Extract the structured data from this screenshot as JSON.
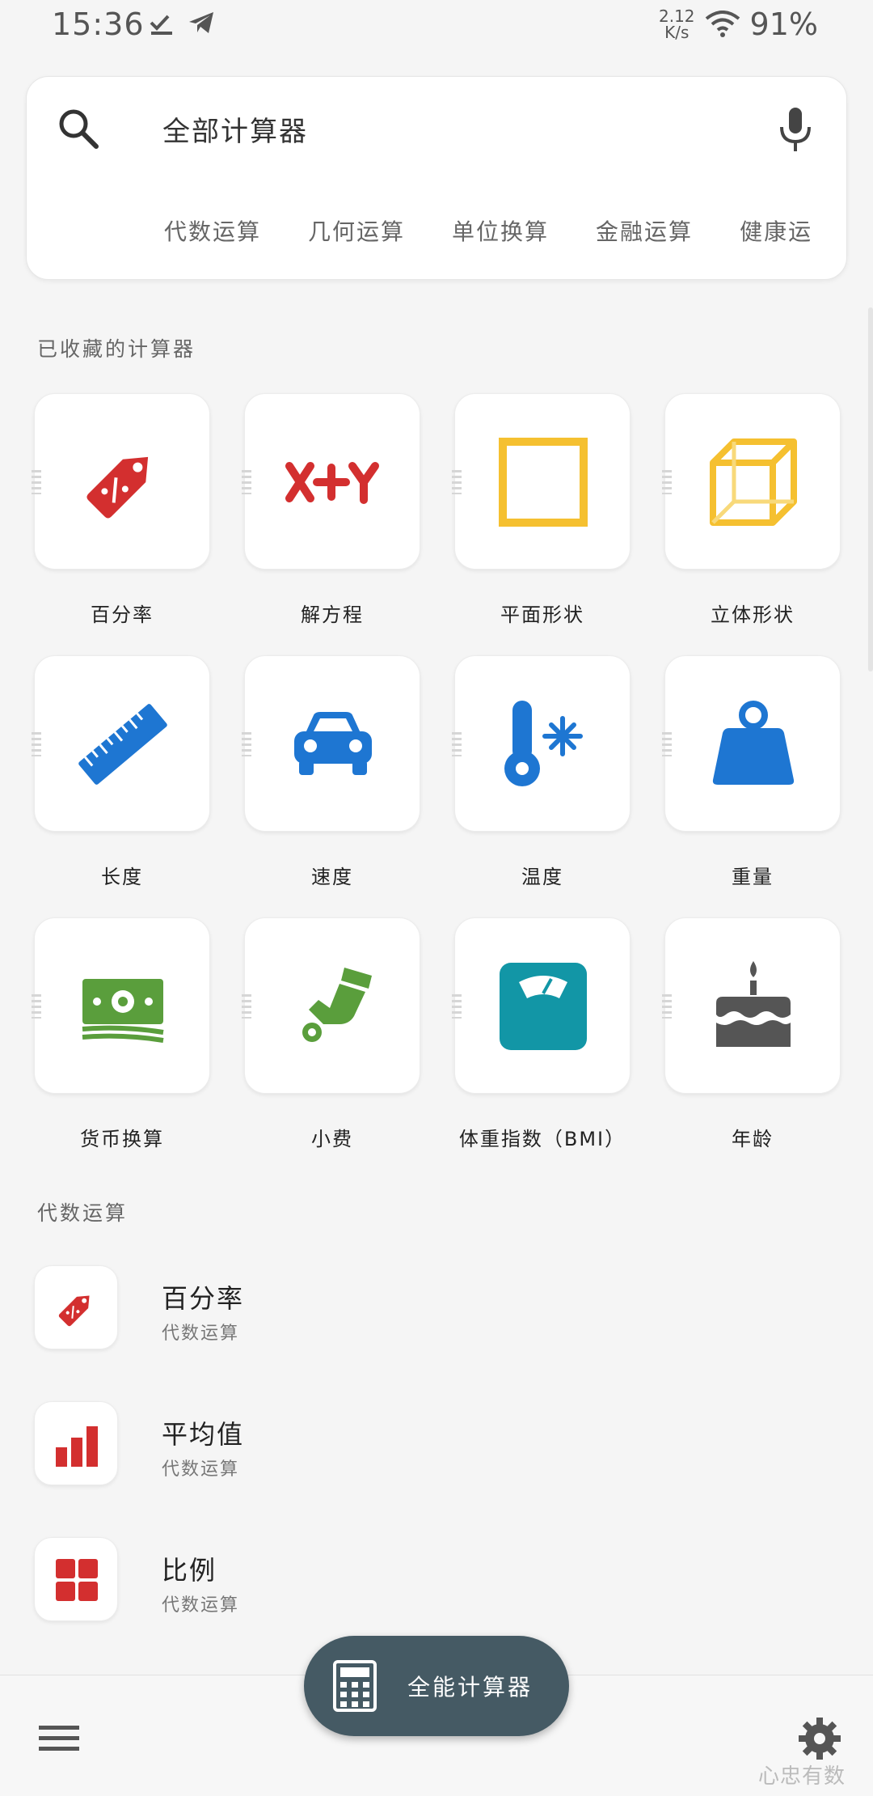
{
  "status": {
    "time": "15:36",
    "net_speed_value": "2.12",
    "net_speed_unit": "K/s",
    "battery": "91%"
  },
  "search": {
    "text": "全部计算器"
  },
  "categories": [
    "代数运算",
    "几何运算",
    "单位换算",
    "金融运算",
    "健康运"
  ],
  "favorites": {
    "title": "已收藏的计算器",
    "items": [
      {
        "label": "百分率",
        "icon": "percent-tag-icon",
        "color": "#d32f2f"
      },
      {
        "label": "解方程",
        "icon": "equation-xy-icon",
        "color": "#d32f2f"
      },
      {
        "label": "平面形状",
        "icon": "square-icon",
        "color": "#f5c030"
      },
      {
        "label": "立体形状",
        "icon": "cube-icon",
        "color": "#f5c030"
      },
      {
        "label": "长度",
        "icon": "ruler-icon",
        "color": "#1e76d2"
      },
      {
        "label": "速度",
        "icon": "car-icon",
        "color": "#1e76d2"
      },
      {
        "label": "温度",
        "icon": "thermometer-icon",
        "color": "#1e76d2"
      },
      {
        "label": "重量",
        "icon": "weight-icon",
        "color": "#1e76d2"
      },
      {
        "label": "货币换算",
        "icon": "money-icon",
        "color": "#5a9e3c"
      },
      {
        "label": "小费",
        "icon": "tip-hand-icon",
        "color": "#5a9e3c"
      },
      {
        "label": "体重指数（BMI）",
        "icon": "scale-icon",
        "color": "#1296a6"
      },
      {
        "label": "年龄",
        "icon": "cake-icon",
        "color": "#555555"
      }
    ]
  },
  "algebra": {
    "title": "代数运算",
    "items": [
      {
        "title": "百分率",
        "subtitle": "代数运算",
        "icon": "percent-tag-icon"
      },
      {
        "title": "平均值",
        "subtitle": "代数运算",
        "icon": "bar-chart-icon"
      },
      {
        "title": "比例",
        "subtitle": "代数运算",
        "icon": "grid-icon"
      }
    ]
  },
  "fab": {
    "label": "全能计算器",
    "icon": "calculator-icon"
  },
  "bottom": {
    "menu_icon": "menu-icon",
    "settings_icon": "gear-icon"
  },
  "watermark": "心忠有数"
}
